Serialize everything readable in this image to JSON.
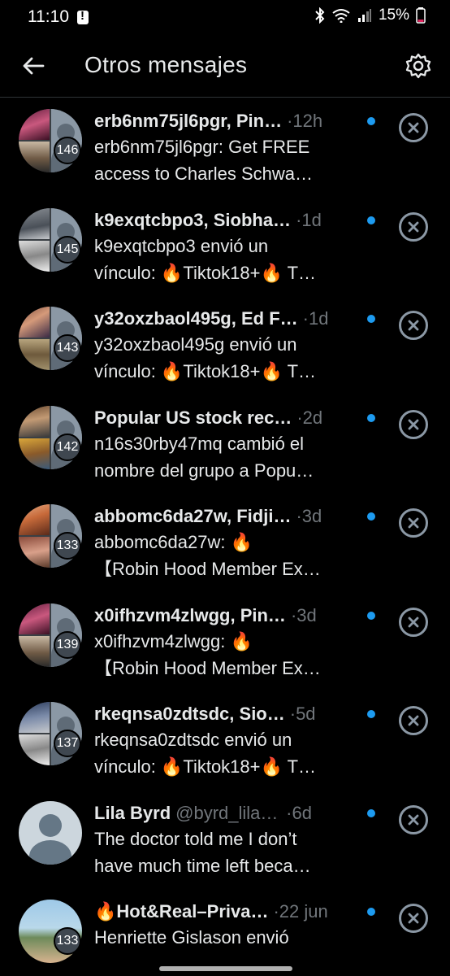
{
  "status_bar": {
    "time": "11:10",
    "battery": "15%"
  },
  "header": {
    "title": "Otros mensajes"
  },
  "conversations": [
    {
      "name": "erb6nm75jl6pgr, Pin…",
      "time": "·12h",
      "line1": "erb6nm75jl6pgr: Get FREE",
      "line2": "access to Charles Schwa…",
      "count": "146"
    },
    {
      "name": "k9exqtcbpo3, Siobha…",
      "time": "·1d",
      "line1": "k9exqtcbpo3 envió un",
      "line2": "vínculo: 🔥Tiktok18+🔥 T…",
      "count": "145"
    },
    {
      "name": "y32oxzbaol495g, Ed F…",
      "time": "·1d",
      "line1": "y32oxzbaol495g envió un",
      "line2": "vínculo: 🔥Tiktok18+🔥 T…",
      "count": "143"
    },
    {
      "name": "Popular US stock rec…",
      "time": "·2d",
      "line1": "n16s30rby47mq cambió el",
      "line2": "nombre del grupo a Popu…",
      "count": "142"
    },
    {
      "name": "abbomc6da27w, Fidji…",
      "time": "·3d",
      "line1": "abbomc6da27w: 🔥",
      "line2": "【Robin Hood Member Ex…",
      "count": "133"
    },
    {
      "name": "x0ifhzvm4zlwgg, Pin…",
      "time": "·3d",
      "line1": "x0ifhzvm4zlwgg: 🔥",
      "line2": "【Robin Hood Member Ex…",
      "count": "139"
    },
    {
      "name": "rkeqnsa0zdtsdc, Sio…",
      "time": "·5d",
      "line1": "rkeqnsa0zdtsdc envió un",
      "line2": "vínculo: 🔥Tiktok18+🔥 T…",
      "count": "137"
    },
    {
      "name": "Lila Byrd",
      "handle": "@byrd_lila4…",
      "time": "·6d",
      "line1": "The doctor told me I don’t",
      "line2": "have much time left beca…"
    },
    {
      "name": "🔥Hot&Real–Priva…",
      "time": "·22 jun",
      "line1": "Henriette Gislason envió",
      "line2": "",
      "count": "133"
    }
  ]
}
